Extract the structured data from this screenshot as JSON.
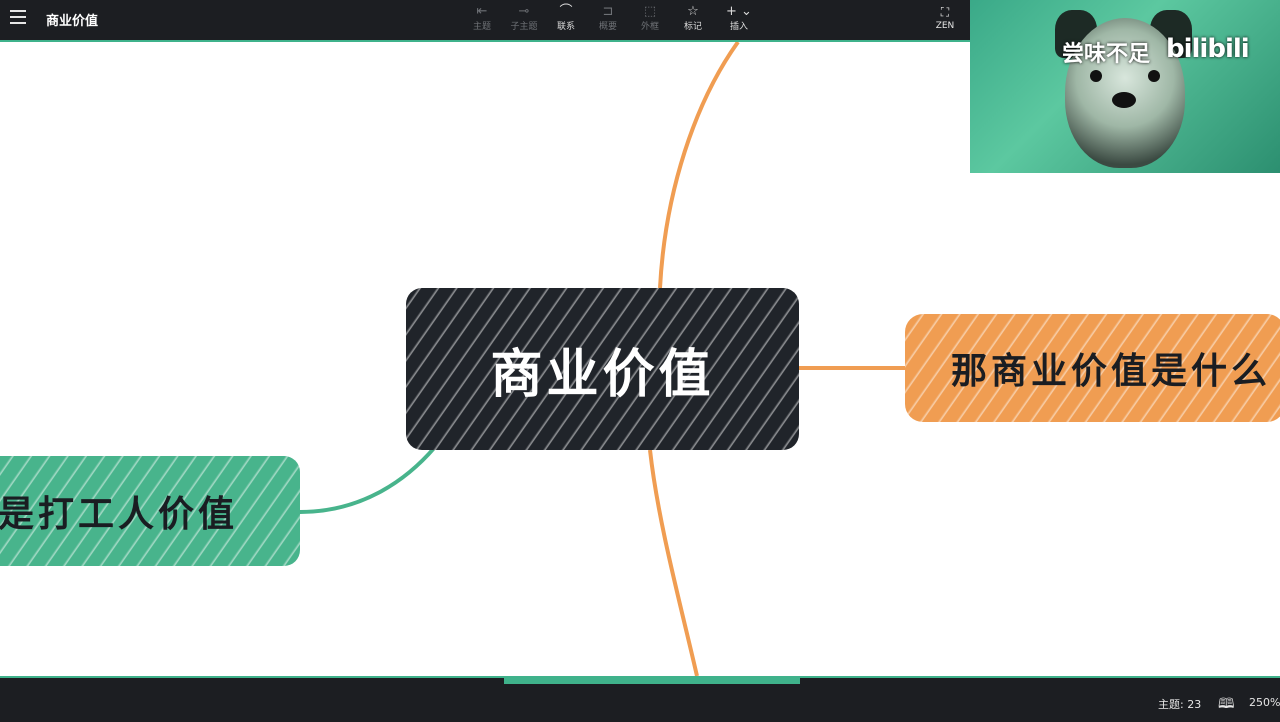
{
  "toolbar": {
    "menu_icon": "hamburger-icon",
    "title": "商业价值",
    "tools": [
      {
        "label": "主题",
        "icon": "topic-icon",
        "enabled": false
      },
      {
        "label": "子主题",
        "icon": "subtopic-icon",
        "enabled": false
      },
      {
        "label": "联系",
        "icon": "relationship-icon",
        "enabled": true
      },
      {
        "label": "概要",
        "icon": "summary-icon",
        "enabled": false
      },
      {
        "label": "外框",
        "icon": "boundary-icon",
        "enabled": false
      },
      {
        "label": "标记",
        "icon": "star-icon",
        "enabled": true
      },
      {
        "label": "插入",
        "icon": "plus-icon",
        "enabled": true
      }
    ],
    "zen_label": "ZEN"
  },
  "overlay": {
    "watermark_text": "尝味不足",
    "logo_text": "bilibili"
  },
  "mindmap": {
    "central": "商业价值",
    "right_topic": "那商业价值是什么",
    "left_topic": "是打工人价值"
  },
  "status": {
    "topic_count": "主题: 23",
    "zoom": "250%"
  },
  "colors": {
    "central_fill": "#20242a",
    "orange_branch": "#f09d52",
    "green_branch": "#48b48c",
    "toolbar_bg": "#1c1e22",
    "accent": "#3fb28b"
  }
}
